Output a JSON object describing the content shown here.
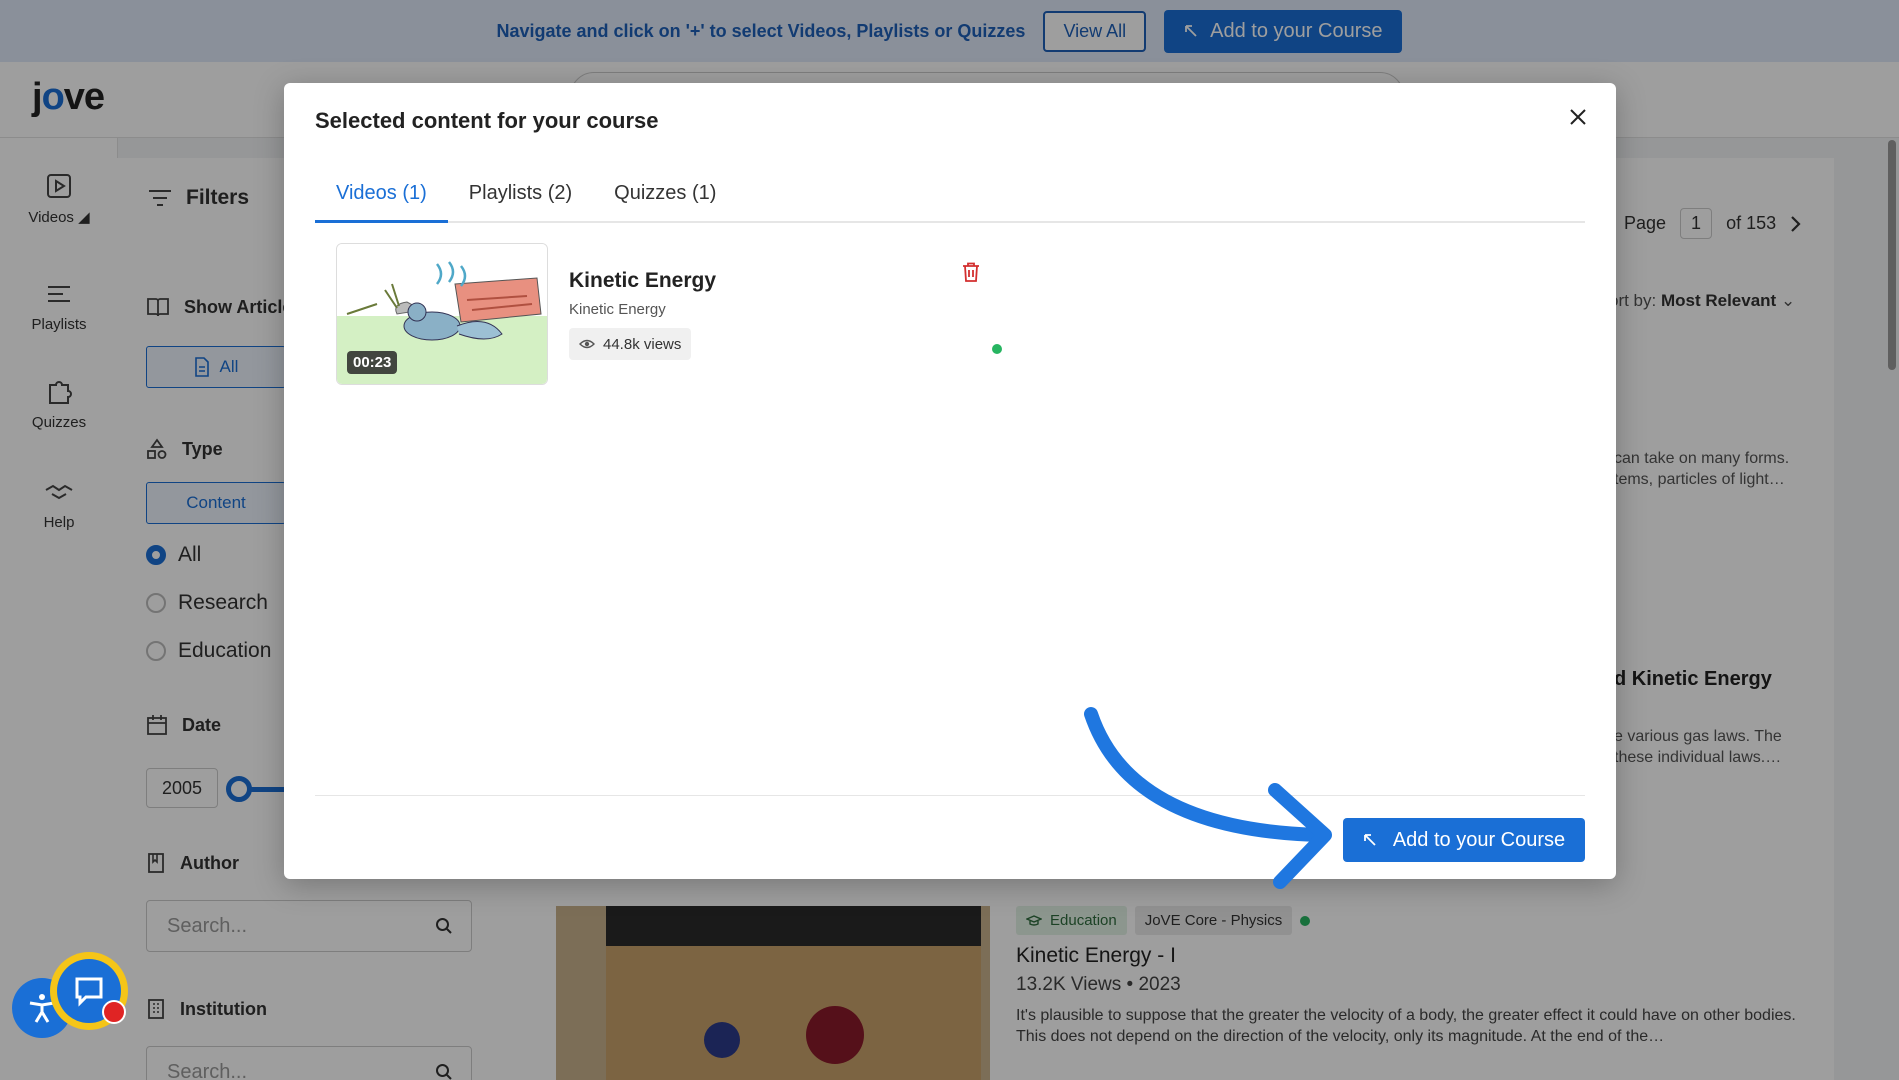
{
  "banner": {
    "text": "Navigate and click on '+' to select Videos, Playlists or Quizzes",
    "view_all_label": "View All",
    "add_label": "Add to your Course"
  },
  "app": {
    "logo_pre": "j",
    "logo_o": "o",
    "logo_post": "ve"
  },
  "rail": {
    "items": [
      {
        "label": "Videos",
        "icon": "video-play-icon"
      },
      {
        "label": "Playlists",
        "icon": "playlist-icon"
      },
      {
        "label": "Quizzes",
        "icon": "puzzle-icon"
      },
      {
        "label": "Help",
        "icon": "handshake-icon"
      }
    ]
  },
  "filters": {
    "title": "Filters",
    "show_articles": "Show Article",
    "all_label": "All",
    "type_label": "Type",
    "content_label": "Content",
    "radio_options": [
      "All",
      "Research",
      "Education"
    ],
    "date_label": "Date",
    "year_from": "2005",
    "author_label": "Author",
    "author_placeholder": "Search...",
    "institution_label": "Institution",
    "institution_placeholder": "Search..."
  },
  "results": {
    "page_label": "Page",
    "page_current": "1",
    "page_total": "of 153",
    "sort_prefix": "ort by: ",
    "sort_value": "Most Relevant",
    "frag1_line1": "can take on many forms.",
    "frag1_line2": "tems, particles of light…",
    "frag2_title": "d Kinetic Energy",
    "frag2_line1": "e various gas laws. The",
    "frag2_line2": "these individual laws.…",
    "card": {
      "badge_education": "Education",
      "badge_core": "JoVE Core - Physics",
      "title": "Kinetic Energy - I",
      "meta": "13.2K Views • 2023",
      "desc": "It's plausible to suppose that the greater the velocity of a body, the greater effect it could have on other bodies. This does not depend on the direction of the velocity, only its magnitude. At the end of the…"
    }
  },
  "modal": {
    "title": "Selected content for your course",
    "tabs": [
      {
        "label": "Videos (1)",
        "active": true
      },
      {
        "label": "Playlists (2)",
        "active": false
      },
      {
        "label": "Quizzes (1)",
        "active": false
      }
    ],
    "item": {
      "duration": "00:23",
      "title": "Kinetic Energy",
      "subtitle": "Kinetic Energy",
      "views": "44.8k views"
    },
    "add_label": "Add to your Course"
  },
  "colors": {
    "accent": "#1a6fd6",
    "status_green": "#27b561",
    "delete_red": "#d32f2f"
  }
}
